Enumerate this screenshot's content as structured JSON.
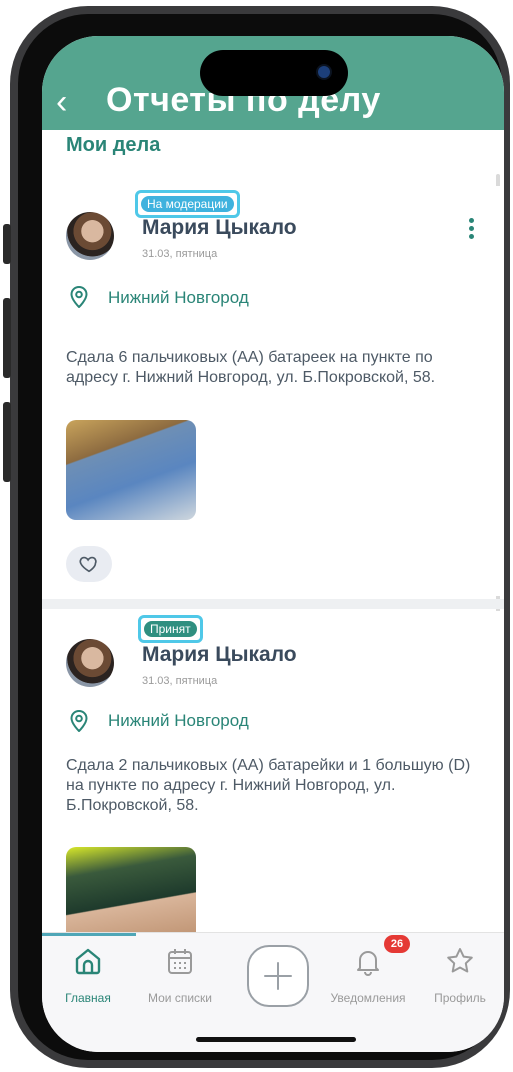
{
  "header": {
    "title": "Отчеты по делу",
    "back_icon": "chevron-left-icon"
  },
  "section": {
    "title": "Мои дела"
  },
  "reports": [
    {
      "status": "На модерации",
      "status_color": "#3fb2de",
      "author": "Мария Цыкало",
      "date": "31.03, пятница",
      "location": "Нижний Новгород",
      "text": "Сдала 6 пальчиковых (АА) батареек на пункте по адресу г. Нижний Новгород, ул. Б.Покровской, 58."
    },
    {
      "status": "Принят",
      "status_color": "#2f8f80",
      "author": "Мария Цыкало",
      "date": "31.03, пятница",
      "location": "Нижний Новгород",
      "text": "Сдала 2 пальчиковых (АА) батарейки и 1 большую (D) на пункте по адресу г. Нижний Новгород, ул. Б.Покровской, 58."
    }
  ],
  "tabbar": {
    "items": [
      {
        "label": "Главная",
        "icon": "home-icon",
        "active": true
      },
      {
        "label": "Мои списки",
        "icon": "calendar-icon"
      },
      {
        "label": "",
        "icon": "plus-icon"
      },
      {
        "label": "Уведомления",
        "icon": "bell-icon",
        "badge": "26"
      },
      {
        "label": "Профиль",
        "icon": "star-icon"
      }
    ]
  },
  "colors": {
    "header_bg": "#55a58f",
    "accent": "#2a8577",
    "badge_outline": "#4fc8e8",
    "notif_badge": "#e53935"
  }
}
